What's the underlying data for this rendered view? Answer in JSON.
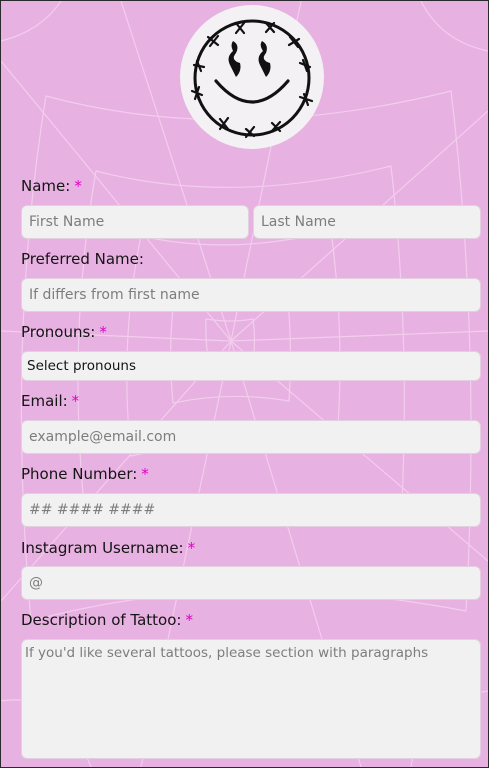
{
  "colors": {
    "background": "#e7b1e1",
    "field_background": "#f2f1f2",
    "required_marker": "#e000c8"
  },
  "logo": {
    "icon": "smiley-barbed-wire-icon"
  },
  "form": {
    "required_marker": "*",
    "name": {
      "label": "Name:",
      "first_placeholder": "First Name",
      "last_placeholder": "Last Name"
    },
    "preferred_name": {
      "label": "Preferred Name:",
      "placeholder": "If differs from first name"
    },
    "pronouns": {
      "label": "Pronouns:",
      "value": "Select pronouns"
    },
    "email": {
      "label": "Email:",
      "placeholder": "example@email.com"
    },
    "phone": {
      "label": "Phone Number:",
      "placeholder": "## #### ####"
    },
    "instagram": {
      "label": "Instagram Username:",
      "placeholder": "@"
    },
    "description": {
      "label": "Description of Tattoo:",
      "placeholder": "If you'd like several tattoos, please section with paragraphs"
    }
  }
}
